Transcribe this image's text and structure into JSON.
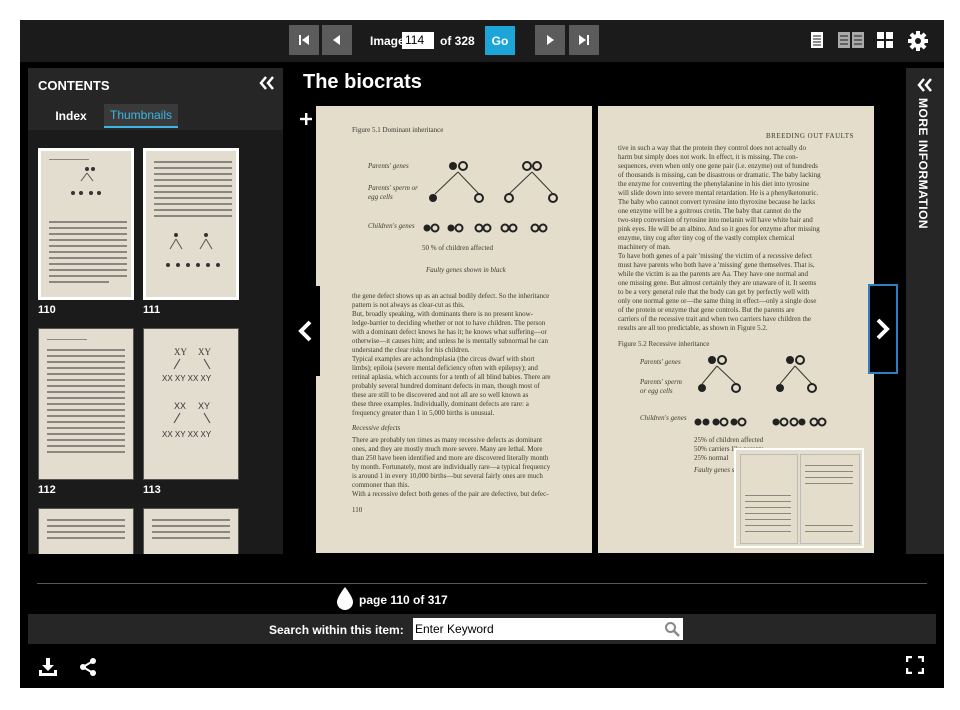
{
  "toolbar": {
    "image_label": "Image",
    "current_image": "114",
    "total_images": "of 328",
    "go_label": "Go"
  },
  "sidebar": {
    "title": "CONTENTS",
    "tabs": [
      "Index",
      "Thumbnails"
    ],
    "thumbnails": [
      "110",
      "111",
      "112",
      "113"
    ]
  },
  "document": {
    "title": "The biocrats",
    "left_page": {
      "figure_caption": "Figure 5.1   Dominant inheritance",
      "labels": [
        "Parents' genes",
        "Parents' sperm or egg cells",
        "Children's genes"
      ],
      "fraction_note": "50 % of children affected",
      "key_note": "Faulty genes shown in black",
      "body": [
        "the gene defect shows up as an actual bodily defect. So the inheritance",
        "pattern is not always as clear-cut as this.",
        "But, broadly speaking, with dominants there is no present know-",
        "ledge-barrier to deciding whether or not to have children. The person",
        "with a dominant defect knows he has it; he knows what suffering—or",
        "otherwise—it causes him; and unless he is mentally subnormal he can",
        "understand the clear risks for his children.",
        "Typical examples are achondroplasia (the circus dwarf with short",
        "limbs); epiloia (severe mental deficiency often with epilepsy); and",
        "retinal aplasia, which accounts for a tenth of all blind babies. There are",
        "probably several hundred dominant defects in man, though most of",
        "these are still to be discovered and not all are so well known as",
        "these three examples. Individually, dominant defects are rare: a",
        "frequency greater than 1 in 5,000 births is unusual."
      ],
      "section_heading": "Recessive defects",
      "body2": [
        "There are probably ten times as many recessive defects as dominant",
        "ones, and they are mostly much more severe. Many are lethal. More",
        "than 250 have been identified and more are discovered literally month",
        "by month. Fortunately, most are individually rare—a typical frequency",
        "is around 1 in every 10,000 births—but several fairly ones are much",
        "commoner than this.",
        "With a recessive defect both genes of the pair are defective, but defec-"
      ],
      "page_number": "110"
    },
    "right_page": {
      "running_head": "BREEDING OUT FAULTS",
      "body": [
        "tive in such a way that the protein they control does not actually do",
        "harm but simply does not work. In effect, it is missing. The con-",
        "sequences, even when only one gene pair (i.e. enzyme) out of hundreds",
        "of thousands is missing, can be disastrous or dramatic. The baby lacking",
        "the enzyme for converting the phenylalanine in his diet into tyrosine",
        "will slide down into severe mental retardation. He is a phenylketonuric.",
        "The baby who cannot convert tyrosine into thyroxine because he lacks",
        "one enzyme will be a goitrous cretin. The baby that cannot do the",
        "two-step conversion of tyrosine into melanin will have white hair and",
        "pink eyes. He will be an albino. And so it goes for enzyme after missing",
        "enzyme, tiny cog after tiny cog of the vastly complex chemical",
        "machinery of man.",
        "To have both genes of a pair 'missing' the victim of a recessive defect",
        "must have parents who both have a 'missing' gene themselves. That is,",
        "while the victim is aa the parents are Aa. They have one normal and",
        "one missing gene. But almost certainly they are unaware of it. It seems",
        "to be a very general rule that the body can get by perfectly well with",
        "only one normal gene or—the same thing in effect—only a single dose",
        "of the protein or enzyme that gene controls. But the parents are",
        "carriers of the recessive trait and when two carriers have children the",
        "results are all too predictable, as shown in Figure 5.2."
      ],
      "figure_caption": "Figure 5.2   Recessive inheritance",
      "labels": [
        "Parents' genes",
        "Parents' sperm or egg cells",
        "Children's genes"
      ],
      "notes": [
        "25% of children affected",
        "50% carriers like parents",
        "25% normal",
        "Faulty genes shown in black"
      ]
    }
  },
  "more_info_label": "MORE INFORMATION",
  "footer": {
    "page_info": "page 110 of 317",
    "search_label": "Search within this item:",
    "search_placeholder": "Enter Keyword"
  }
}
